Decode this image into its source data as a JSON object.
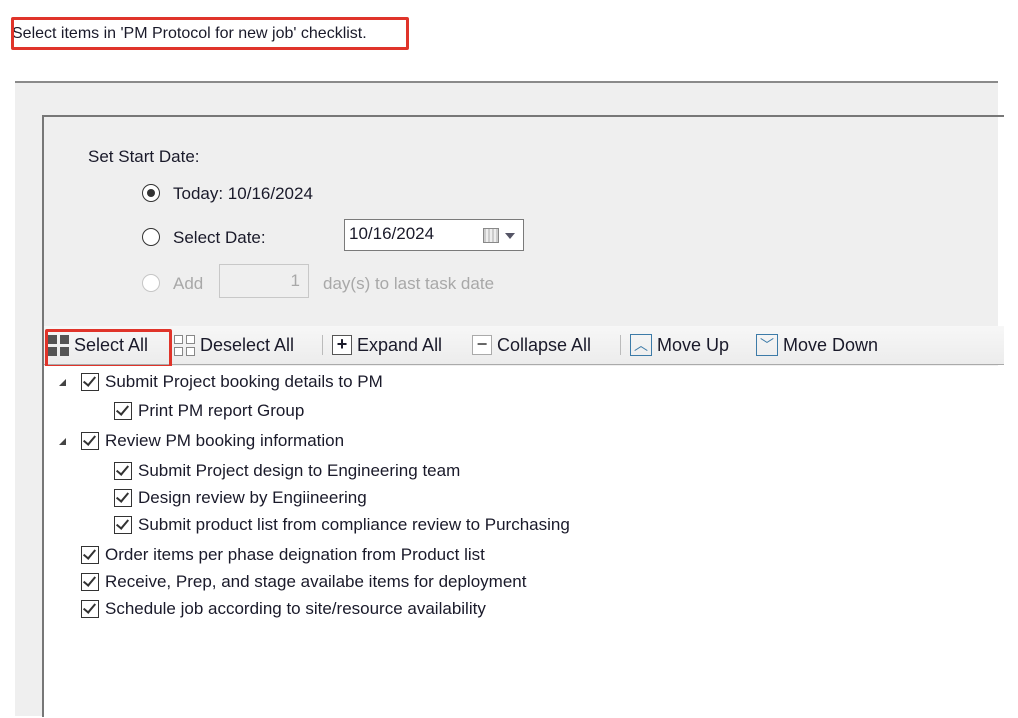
{
  "instruction": "Select items in 'PM Protocol for new job' checklist.",
  "start_date": {
    "label": "Set Start Date:",
    "today_label": "Today: 10/16/2024",
    "select_date_label": "Select Date:",
    "select_date_value": "10/16/2024",
    "add_label": "Add",
    "add_value": "1",
    "add_suffix": "day(s) to last task date",
    "selected": "today"
  },
  "toolbar": {
    "select_all": "Select All",
    "deselect_all": "Deselect All",
    "expand_all": "Expand All",
    "collapse_all": "Collapse All",
    "move_up": "Move Up",
    "move_down": "Move Down"
  },
  "tree": [
    {
      "label": "Submit Project booking details to PM",
      "checked": true,
      "level": 0,
      "expanded": true
    },
    {
      "label": "Print PM report Group",
      "checked": true,
      "level": 1
    },
    {
      "label": "Review PM booking information",
      "checked": true,
      "level": 0,
      "expanded": true
    },
    {
      "label": "Submit Project design to Engineering team",
      "checked": true,
      "level": 1
    },
    {
      "label": "Design review by Engiineering",
      "checked": true,
      "level": 1
    },
    {
      "label": "Submit product list from compliance review to Purchasing",
      "checked": true,
      "level": 1
    },
    {
      "label": "Order items per phase deignation from Product list",
      "checked": true,
      "level": 0
    },
    {
      "label": "Receive, Prep, and stage availabe items for deployment",
      "checked": true,
      "level": 0
    },
    {
      "label": "Schedule job according to site/resource availability",
      "checked": true,
      "level": 0
    }
  ],
  "colors": {
    "highlight": "#e0342a",
    "accent": "#3d7ba8"
  }
}
